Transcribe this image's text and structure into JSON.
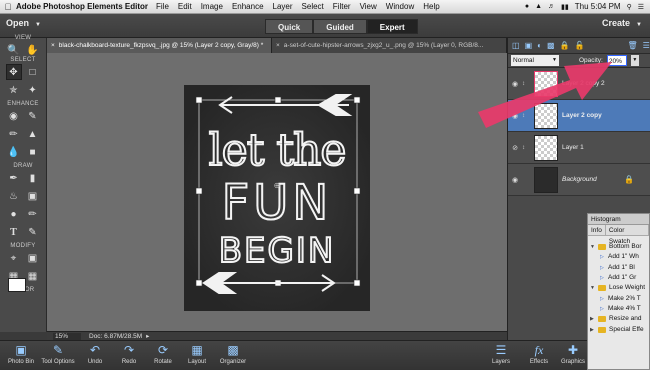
{
  "menubar": {
    "app_name": "Adobe Photoshop Elements Editor",
    "items": [
      "File",
      "Edit",
      "Image",
      "Enhance",
      "Layer",
      "Select",
      "Filter",
      "View",
      "Window",
      "Help"
    ],
    "clock": "Thu 5:04 PM"
  },
  "modebar": {
    "open_label": "Open",
    "tabs": [
      "Quick",
      "Guided",
      "Expert"
    ],
    "active_tab": "Expert",
    "create_label": "Create"
  },
  "toolbox": {
    "sections": [
      "VIEW",
      "SELECT",
      "ENHANCE",
      "DRAW",
      "MODIFY",
      "COLOR"
    ]
  },
  "doc_tabs": [
    {
      "label": "black-chalkboard-texture_fkzpsvq_.jpg @ 15% (Layer 2 copy, Gray/8) *",
      "active": true
    },
    {
      "label": "a-set-of-cute-hipster-arrows_zjxg2_u_.png @ 15% (Layer 0, RGB/8...",
      "active": false
    }
  ],
  "artwork": {
    "line1": "let the",
    "line2": "FUN",
    "line3": "BEGIN"
  },
  "statusbar": {
    "zoom": "15%",
    "doc_info": "Doc: 6.87M/28.5M"
  },
  "layers_panel": {
    "blend_mode": "Normal",
    "opacity_label": "Opacity:",
    "opacity_value": "20%",
    "layers": [
      {
        "name": "Layer 2 copy 2",
        "selected": false
      },
      {
        "name": "Layer 2 copy",
        "selected": true
      },
      {
        "name": "Layer 1",
        "selected": false
      },
      {
        "name": "Background",
        "selected": false
      }
    ]
  },
  "histogram_panel": {
    "title": "Histogram",
    "tabs": [
      "Info",
      "Color Swatch"
    ],
    "actions": [
      {
        "label": "Bottom Bor",
        "type": "folder"
      },
      {
        "label": "Add 1\" Wh",
        "type": "item"
      },
      {
        "label": "Add 1\" Bl",
        "type": "item"
      },
      {
        "label": "Add 1\" Gr",
        "type": "item"
      },
      {
        "label": "Lose Weight",
        "type": "folder"
      },
      {
        "label": "Make 2% T",
        "type": "item"
      },
      {
        "label": "Make 4% T",
        "type": "item"
      },
      {
        "label": "Resize and",
        "type": "folder"
      },
      {
        "label": "Special Effe",
        "type": "folder"
      }
    ]
  },
  "taskbar": {
    "left": [
      {
        "label": "Photo Bin",
        "icon": "photo-bin-icon"
      },
      {
        "label": "Tool Options",
        "icon": "tool-options-icon"
      },
      {
        "label": "Undo",
        "icon": "undo-icon"
      },
      {
        "label": "Redo",
        "icon": "redo-icon"
      },
      {
        "label": "Rotate",
        "icon": "rotate-icon"
      },
      {
        "label": "Layout",
        "icon": "layout-icon"
      },
      {
        "label": "Organizer",
        "icon": "organizer-icon"
      }
    ],
    "right": [
      {
        "label": "Layers",
        "icon": "layers-icon"
      },
      {
        "label": "Effects",
        "icon": "effects-icon"
      },
      {
        "label": "Graphics",
        "icon": "graphics-icon"
      }
    ]
  },
  "colors": {
    "accent_selected": "#4d7ab8",
    "annotation_arrow": "#e8396a"
  }
}
